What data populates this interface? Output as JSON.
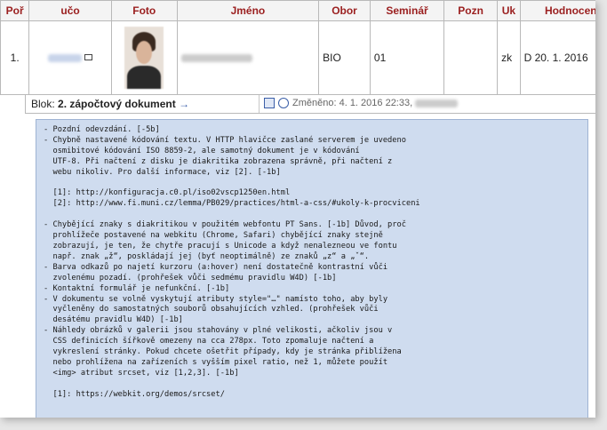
{
  "table": {
    "headers": [
      "Poř",
      "učo",
      "Foto",
      "Jméno",
      "Obor",
      "Seminář",
      "Pozn",
      "Uk",
      "Hodnocen"
    ],
    "row": {
      "poradi": "1.",
      "obor": "BIO",
      "seminar": "01",
      "pozn": "",
      "uk": "zk",
      "hodnoceni": "D 20. 1. 2016"
    }
  },
  "subrow": {
    "blok_prefix": "Blok:",
    "blok_name": "2. zápočtový dokument",
    "arrow": "→",
    "changed": "Změněno: 4. 1. 2016 22:33,"
  },
  "comment": {
    "text": "- Pozdní odevzdání. [-5b]\n- Chybně nastavené kódování textu. V HTTP hlavičce zaslané serverem je uvedeno\n  osmibitové kódování ISO 8859-2, ale samotný dokument je v kódování\n  UTF-8. Při načtení z disku je diakritika zobrazena správně, při načtení z\n  webu nikoliv. Pro další informace, viz [2]. [-1b]\n\n  [1]: http://konfiguracja.c0.pl/iso02vscp1250en.html\n  [2]: http://www.fi.muni.cz/lemma/PB029/practices/html-a-css/#ukoly-k-procviceni\n\n- Chybějící znaky s diakritikou v použitém webfontu PT Sans. [-1b] Důvod, proč\n  prohlížeče postavené na webkitu (Chrome, Safari) chybějící znaky stejně\n  zobrazují, je ten, že chytře pracují s Unicode a když nenalezneou ve fontu\n  např. znak „ž“, poskládají jej (byť neoptimálně) ze znaků „z“ a „ˇ“.\n- Barva odkazů po najetí kurzoru (a:hover) není dostatečně kontrastní vůči\n  zvolenému pozadí. (prohřešek vůči sedmému pravidlu W4D) [-1b]\n- Kontaktní formulář je nefunkční. [-1b]\n- V dokumentu se volně vyskytují atributy style=\"…\" namísto toho, aby byly\n  vyčleněny do samostatných souborů obsahujících vzhled. (prohřešek vůči\n  desátému pravidlu W4D) [-1b]\n- Náhledy obrázků v galerii jsou stahovány v plné velikosti, ačkoliv jsou v\n  CSS definicích šířkově omezeny na cca 278px. Toto zpomaluje načtení a\n  vykreslení stránky. Pokud chcete ošetřit případy, kdy je stránka přiblížena\n  nebo prohlížena na zařízeních s vyšším pixel ratio, než 1, můžete použít\n  <img> atribut srcset, viz [1,2,3]. [-1b]\n\n  [1]: https://webkit.org/demos/srcset/"
  }
}
